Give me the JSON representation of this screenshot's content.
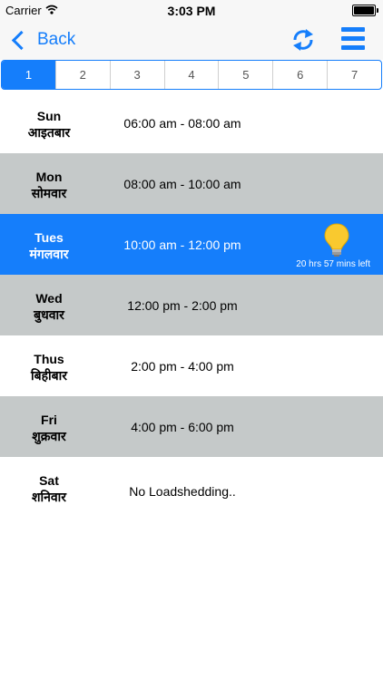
{
  "status_bar": {
    "carrier": "Carrier",
    "time": "3:03 PM"
  },
  "nav": {
    "back_label": "Back"
  },
  "tabs": [
    "1",
    "2",
    "3",
    "4",
    "5",
    "6",
    "7"
  ],
  "selected_tab": 0,
  "schedule": [
    {
      "day_en": "Sun",
      "day_hi": "आइतबार",
      "time": "06:00 am - 08:00 am"
    },
    {
      "day_en": "Mon",
      "day_hi": "सोमवार",
      "time": "08:00 am - 10:00 am"
    },
    {
      "day_en": "Tues",
      "day_hi": "मंगलवार",
      "time": "10:00 am - 12:00 pm",
      "remaining": "20 hrs 57 mins left"
    },
    {
      "day_en": "Wed",
      "day_hi": "बुधवार",
      "time": "12:00 pm - 2:00 pm"
    },
    {
      "day_en": "Thus",
      "day_hi": "बिहीबार",
      "time": "2:00 pm - 4:00 pm"
    },
    {
      "day_en": "Fri",
      "day_hi": "शुक्रवार",
      "time": "4:00 pm - 6:00 pm"
    },
    {
      "day_en": "Sat",
      "day_hi": "शनिवार",
      "time": "No Loadshedding.."
    }
  ],
  "colors": {
    "accent": "#157efb",
    "grey_row": "#c5c9c9",
    "bulb": "#f9c92f"
  },
  "icons": {
    "wifi": "wifi-icon",
    "battery": "battery-icon",
    "back": "chevron-left-icon",
    "refresh": "refresh-icon",
    "menu": "hamburger-menu-icon",
    "bulb": "light-bulb-icon"
  }
}
